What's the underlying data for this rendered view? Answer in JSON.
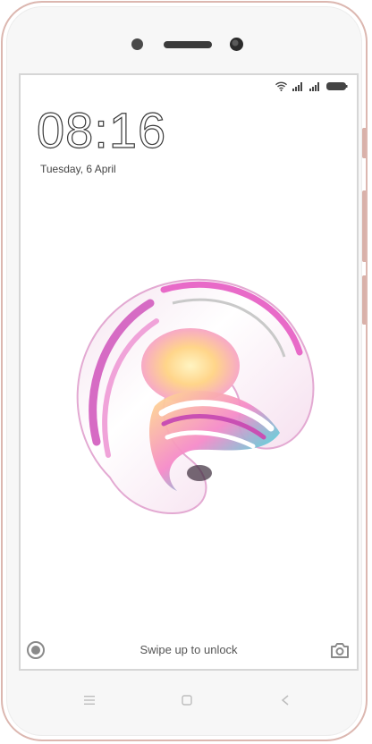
{
  "lockscreen": {
    "time": "08:16",
    "date": "Tuesday, 6 April",
    "unlock_hint": "Swipe up to unlock"
  },
  "status_icons": [
    "wifi-icon",
    "signal-icon",
    "signal-icon",
    "battery-icon"
  ],
  "lock_shortcuts": {
    "left": "circle-shortcut-icon",
    "right": "camera-icon"
  },
  "nav_keys": [
    "menu-icon",
    "home-icon",
    "back-icon"
  ],
  "colors": {
    "device_frame": "#dcb7b0",
    "text": "#3a3a3a",
    "wallpaper_accent": "#e05fc0"
  }
}
